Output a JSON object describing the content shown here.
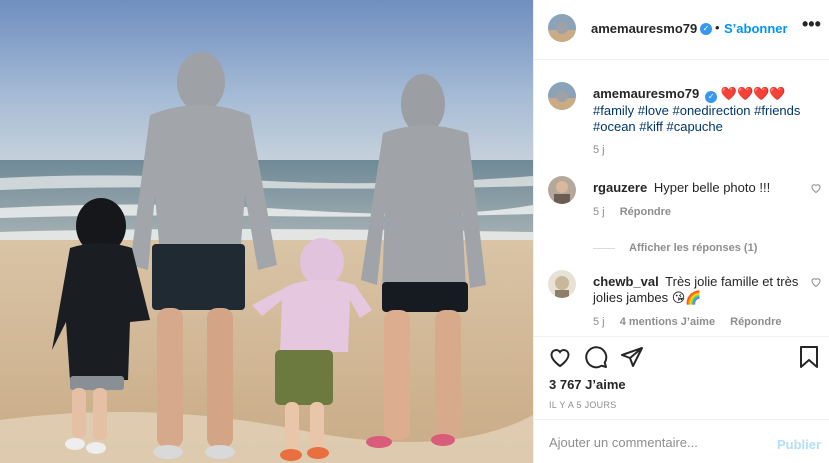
{
  "post": {
    "username": "amemauresmo79",
    "follow_label": "S’abonner",
    "more_label": "•••",
    "caption_hearts": "❤️❤️❤️❤️",
    "caption_tags": "#family #love #onedirection #friends #ocean #kiff #capuche",
    "caption_age": "5 j",
    "photo_icon": "family-beach-photo"
  },
  "comments": [
    {
      "username": "rgauzere",
      "text": "Hyper belle photo !!!",
      "age": "5 j",
      "reply_label": "Répondre",
      "view_replies_label": "Afficher les réponses (1)"
    },
    {
      "username": "chewb_val",
      "text": "Très jolie famille et très jolies jambes 😘🌈",
      "age": "5 j",
      "likes_label": "4 mentions J’aime",
      "reply_label": "Répondre"
    }
  ],
  "actions": {
    "icons": [
      "heart-icon",
      "comment-icon",
      "share-icon",
      "bookmark-icon"
    ],
    "likes": "3 767 J’aime",
    "timestamp": "IL Y A 5 JOURS"
  },
  "add_comment": {
    "placeholder": "Ajouter un commentaire...",
    "post_label": "Publier"
  },
  "colors": {
    "link_blue": "#0095f6",
    "hashtag_blue": "#00376b",
    "verified_blue": "#3897f0",
    "muted_gray": "#8e8e8e",
    "border": "#efefef"
  }
}
